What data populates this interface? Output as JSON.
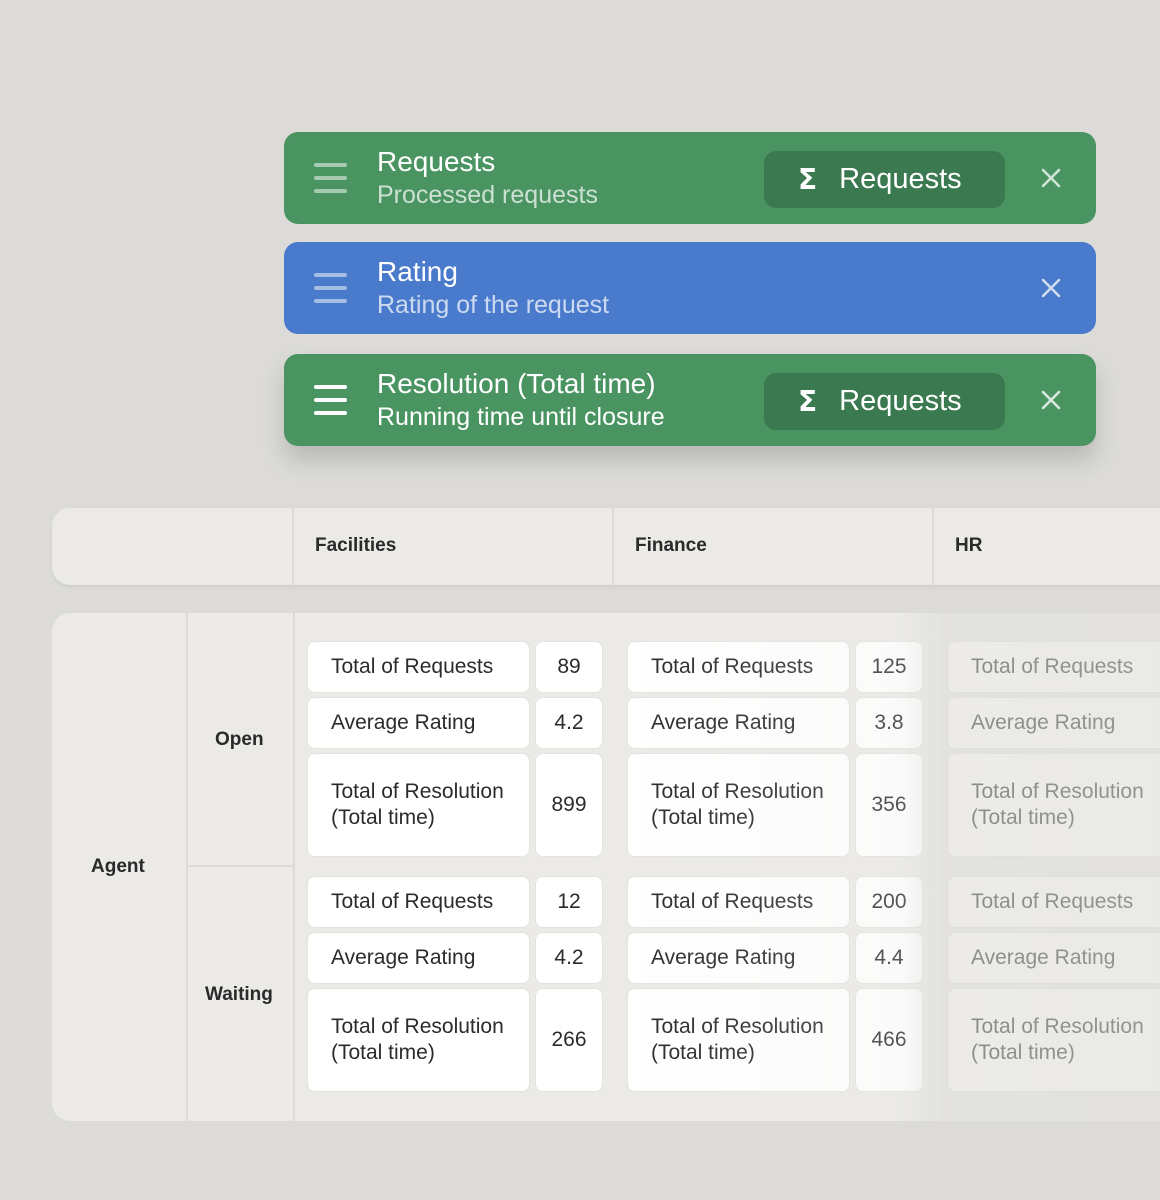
{
  "fields": [
    {
      "title": "Requests",
      "subtitle": "Processed requests",
      "aggregation": "Requests",
      "color": "#4a9462"
    },
    {
      "title": "Rating",
      "subtitle": "Rating of the request",
      "color": "#4a7acb"
    },
    {
      "title": "Resolution (Total time)",
      "subtitle": "Running time until closure",
      "aggregation": "Requests",
      "color": "#4a9462"
    }
  ],
  "aggregation_icon": "Σ",
  "icons": {
    "drag": "drag-handle-icon",
    "close": "close-icon",
    "sigma": "sigma-icon"
  },
  "pivot": {
    "columns": [
      "Facilities",
      "Finance",
      "HR"
    ],
    "row_group": "Agent",
    "rows": [
      "Open",
      "Waiting"
    ],
    "measure_labels": {
      "requests": "Total of Requests",
      "rating": "Average Rating",
      "resolution": "Total of Resolution (Total time)"
    },
    "values": {
      "open": {
        "facilities": {
          "requests": "89",
          "rating": "4.2",
          "resolution": "899"
        },
        "finance": {
          "requests": "125",
          "rating": "3.8",
          "resolution": "356"
        }
      },
      "waiting": {
        "facilities": {
          "requests": "12",
          "rating": "4.2",
          "resolution": "266"
        },
        "finance": {
          "requests": "200",
          "rating": "4.4",
          "resolution": "466"
        }
      }
    }
  }
}
